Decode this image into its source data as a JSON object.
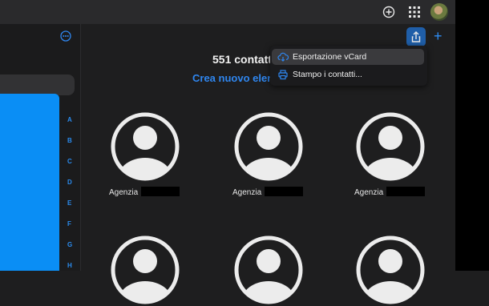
{
  "sidebar": {
    "index_letters": [
      "A",
      "B",
      "C",
      "D",
      "E",
      "F",
      "G",
      "H"
    ]
  },
  "main": {
    "contact_count": "551 contatt",
    "create_link": "Crea nuovo elenc"
  },
  "menu": {
    "items": [
      {
        "label": "Esportazione vCard",
        "icon": "cloud-download-icon"
      },
      {
        "label": "Stampo i contatti...",
        "icon": "printer-icon"
      }
    ]
  },
  "contacts": [
    {
      "name": "Agenzia"
    },
    {
      "name": "Agenzia"
    },
    {
      "name": "Agenzia"
    },
    {
      "name": ""
    },
    {
      "name": ""
    },
    {
      "name": ""
    }
  ],
  "colors": {
    "accent": "#2f86ef",
    "index_bar": "#0a8ef5",
    "background": "#1e1e1f"
  }
}
